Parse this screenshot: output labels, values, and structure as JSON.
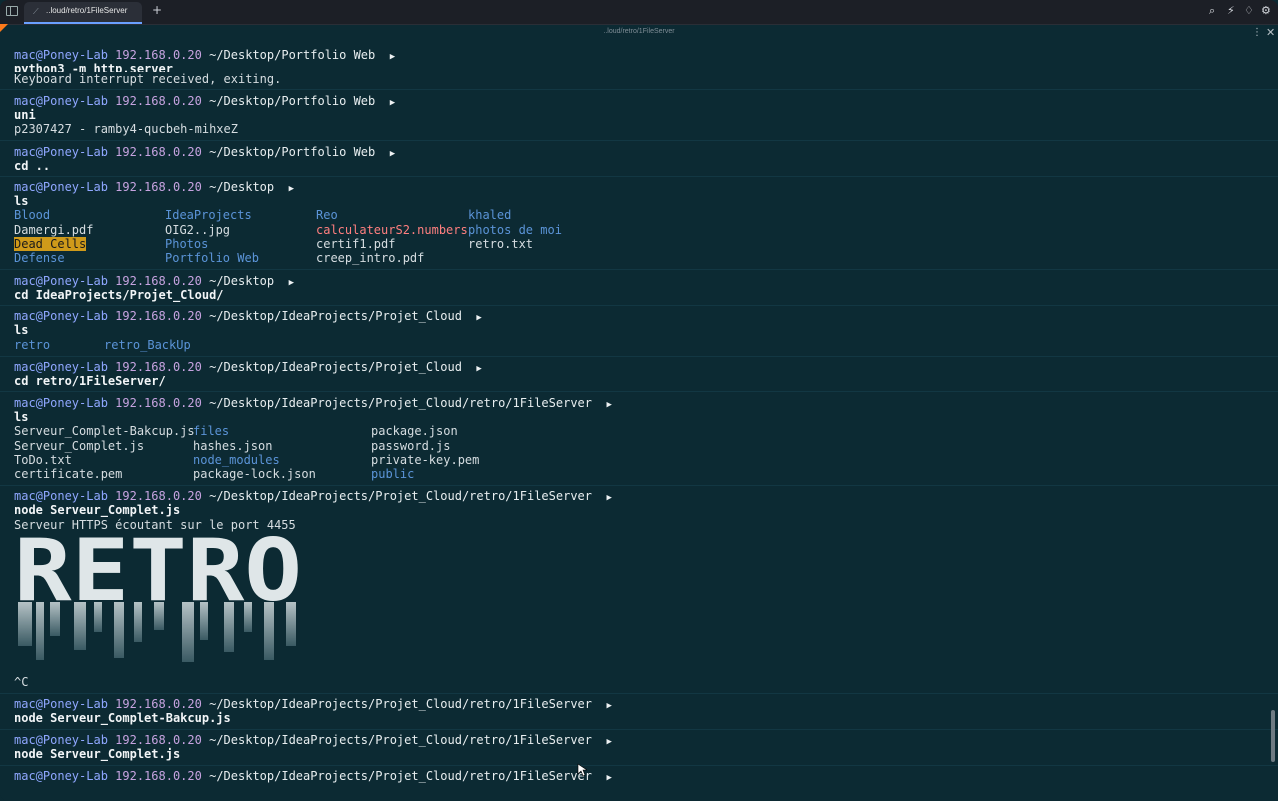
{
  "tab": {
    "label": "..loud/retro/1FileServer",
    "icon": "terminal-icon"
  },
  "title": "..loud/retro/1FileServer",
  "prompt": {
    "user": "mac@Poney-Lab",
    "ip": "192.168.0.20",
    "arrow": "▶"
  },
  "paths": {
    "portfolio": "~/Desktop/Portfolio Web",
    "desktop": "~/Desktop",
    "projet": "~/Desktop/IdeaProjects/Projet_Cloud",
    "server": "~/Desktop/IdeaProjects/Projet_Cloud/retro/1FileServer"
  },
  "commands": {
    "c1": "python3 -m http.server",
    "c2": "uni",
    "c3": "cd ..",
    "c4": "ls",
    "c5": "cd IdeaProjects/Projet_Cloud/",
    "c6": "ls",
    "c7": "cd retro/1FileServer/",
    "c8": "ls",
    "c9": "node Serveur_Complet.js",
    "c10": "node Serveur_Complet-Bakcup.js",
    "c11": "node Serveur_Complet.js"
  },
  "outputs": {
    "o1": "Keyboard interrupt received, exiting.",
    "o2": "p2307427 - ramby4-qucbeh-mihxeZ",
    "o9": "Serveur HTTPS écoutant sur le port 4455",
    "ctrl_c": "^C",
    "art_text": "RETRO"
  },
  "ls_desktop": [
    [
      "Blood",
      "IdeaProjects",
      "Reo",
      "khaled"
    ],
    [
      "Damergi.pdf",
      "OIG2..jpg",
      "calculateurS2.numbers",
      "photos de moi"
    ],
    [
      "Dead Cells",
      "Photos",
      "certif1.pdf",
      "retro.txt"
    ],
    [
      "Defense",
      "Portfolio Web",
      "creep_intro.pdf",
      ""
    ]
  ],
  "ls_projet": [
    "retro",
    "retro_BackUp"
  ],
  "ls_server": [
    [
      "Serveur_Complet-Bakcup.js",
      "files",
      "package.json"
    ],
    [
      "Serveur_Complet.js",
      "hashes.json",
      "password.js"
    ],
    [
      "ToDo.txt",
      "node_modules",
      "private-key.pem"
    ],
    [
      "certificate.pem",
      "package-lock.json",
      "public"
    ]
  ],
  "colors": {
    "background": "#0c2a33",
    "user": "#8fa7ff",
    "ip": "#c6a3e0",
    "directory": "#5b94d8",
    "highlight": "#cf9a1a",
    "accent": "#ff7a1a"
  }
}
